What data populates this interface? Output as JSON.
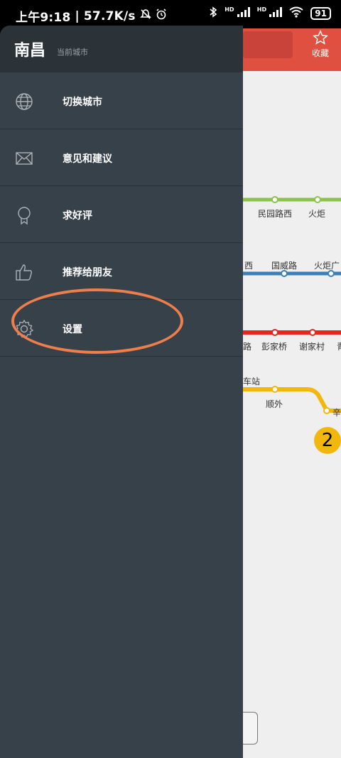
{
  "status_bar": {
    "time": "上午9:18",
    "speed": "57.7K/s",
    "battery": "91",
    "hd1": "HD",
    "hd2": "HD"
  },
  "drawer": {
    "city": "南昌",
    "city_subtitle": "当前城市",
    "items": [
      {
        "label": "切换城市",
        "icon": "globe-icon"
      },
      {
        "label": "意见和建议",
        "icon": "mail-icon"
      },
      {
        "label": "求好评",
        "icon": "award-icon"
      },
      {
        "label": "推荐给朋友",
        "icon": "thumbs-up-icon"
      },
      {
        "label": "设置",
        "icon": "gear-icon"
      }
    ]
  },
  "background_app": {
    "favorite_label": "收藏",
    "stations": {
      "s1": "民园路西",
      "s2": "火炬",
      "s3": "西",
      "s4": "国威路",
      "s5": "火炬广",
      "s6": "路",
      "s7": "彭家桥",
      "s8": "谢家村",
      "s9": "青",
      "s10": "车站",
      "s11": "顺外",
      "s12": "辛"
    },
    "line_badge": "2",
    "colors": {
      "line_green": "#8bc34a",
      "line_blue": "#3b7fb8",
      "line_red": "#e52720",
      "line_yellow": "#f2b70c",
      "header_red": "#e05040"
    }
  },
  "colors": {
    "drawer_bg": "#37414a",
    "drawer_header_bg": "#2b3339",
    "highlight_ring": "#ee7e4b"
  }
}
